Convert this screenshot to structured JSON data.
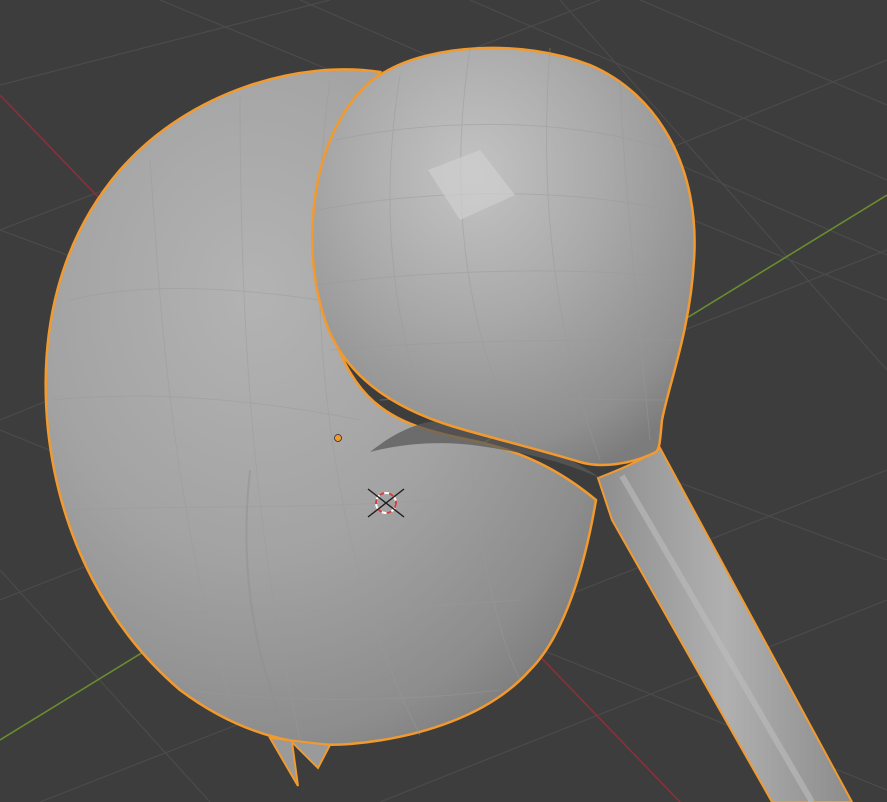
{
  "viewport": {
    "background": "#3d3d3d",
    "grid_color": "#4b4b4b",
    "x_axis_color": "#8a2f3c",
    "y_axis_color": "#6a8c2e"
  },
  "object": {
    "selected": true,
    "selection_outline_color": "#f29a2e",
    "shading": "solid",
    "base_color": "#a6a6a6"
  },
  "origin_point_color": "#f29a2e",
  "cursor_3d": {
    "ring_colors": [
      "#d23c3c",
      "#ffffff"
    ],
    "crosshair_color": "#1e1e1e"
  }
}
